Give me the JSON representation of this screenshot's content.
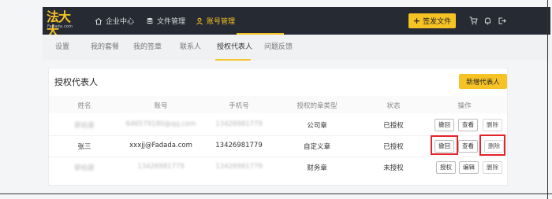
{
  "app": {
    "logo_text": "法大大",
    "logo_sub": "Fadada.com"
  },
  "topnav": {
    "items": [
      {
        "label": "企业中心",
        "icon": "home-icon"
      },
      {
        "label": "文件管理",
        "icon": "database-icon"
      },
      {
        "label": "账号管理",
        "icon": "user-icon",
        "active": true
      }
    ],
    "sign_button": "签发文件",
    "icons": [
      "cart-icon",
      "bell-icon",
      "logout-icon"
    ],
    "accent_color": "#f6c324"
  },
  "subtabs": [
    {
      "label": "设置"
    },
    {
      "label": "我的套餐"
    },
    {
      "label": "我的签章"
    },
    {
      "label": "联系人"
    },
    {
      "label": "授权代表人",
      "active": true
    },
    {
      "label": "问题反馈"
    }
  ],
  "card": {
    "title": "授权代表人",
    "new_button": "新增代表人"
  },
  "table": {
    "columns": [
      "姓名",
      "账号",
      "手机号",
      "授权的章类型",
      "状态",
      "操作"
    ],
    "rows": [
      {
        "name": "郭伯豪",
        "account": "646579180@qq.com",
        "phone": "13426981779",
        "seal_type": "公司章",
        "status": "已授权",
        "actions": [
          "撤回",
          "查看",
          "删除"
        ]
      },
      {
        "name": "张三",
        "account": "xxxjj@Fadada.com",
        "phone": "13426981779",
        "seal_type": "自定义章",
        "status": "已授权",
        "actions": [
          "撤回",
          "查看",
          "删除"
        ]
      },
      {
        "name": "郭伯豪",
        "account": "13426981779",
        "phone": "13426981779",
        "seal_type": "财务章",
        "status": "未授权",
        "actions": [
          "授权",
          "编辑",
          "删除"
        ]
      }
    ],
    "highlight_color": "#e2232a"
  }
}
